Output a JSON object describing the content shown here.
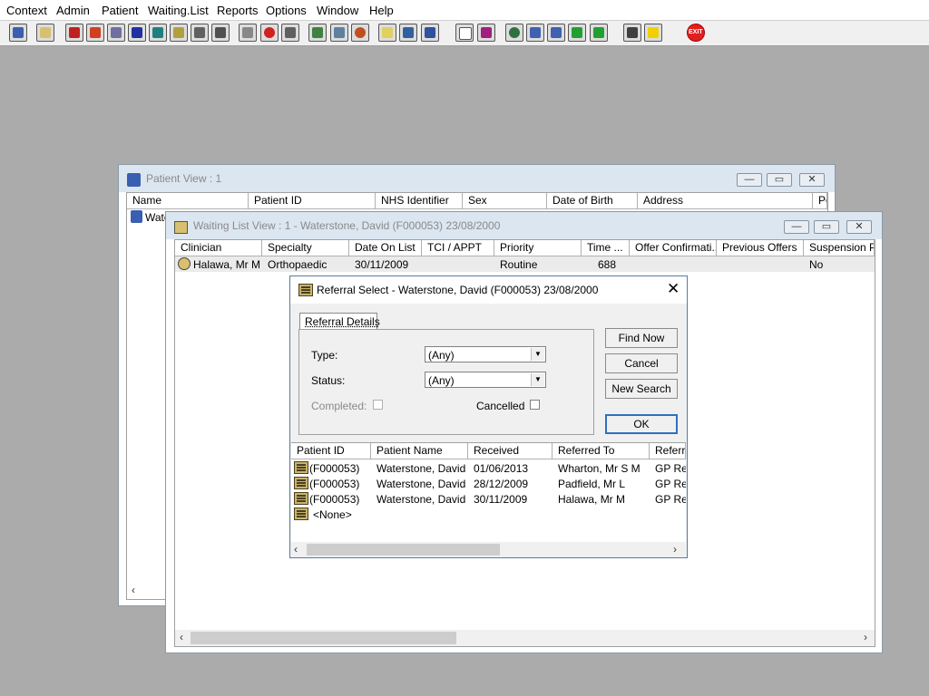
{
  "menu": [
    "Context",
    "Admin",
    "Patient",
    "Waiting.List",
    "Reports",
    "Options",
    "Window",
    "Help"
  ],
  "toolbar_icons": [
    "user-icon",
    "printer-icon",
    "book-icon",
    "edit-icon",
    "card-icon",
    "m-icon",
    "doctor-icon",
    "notepad-icon",
    "ambulance-icon",
    "vehicle-icon",
    "search-doc-icon",
    "clock-icon",
    "list-icon",
    "image-icon",
    "form-icon",
    "gauge-icon",
    "note-icon",
    "bed-icon",
    "person-chair-icon",
    "document-icon",
    "chart-icon",
    "globe-icon",
    "check-list-icon",
    "check-doc-icon",
    "arrow-down-icon",
    "arrow-up-icon",
    "transfer-icon",
    "warning-icon",
    "exit-icon"
  ],
  "exit_label": "EXIT",
  "patient_view": {
    "title": "Patient View : 1",
    "columns": [
      "Name",
      "Patient ID",
      "NHS Identifier",
      "Sex",
      "Date of Birth",
      "Address",
      "Po"
    ],
    "row_name": "Wate"
  },
  "waiting_list": {
    "title": "Waiting List View :  1 - Waterstone, David (F000053) 23/08/2000",
    "columns": [
      "Clinician",
      "Specialty",
      "Date On List",
      "TCI / APPT",
      "Priority",
      "Time ...",
      "Offer Confirmati...",
      "Previous Offers",
      "Suspension Pe"
    ],
    "row": {
      "clinician": "Halawa, Mr M",
      "specialty": "Orthopaedic",
      "date_on_list": "30/11/2009",
      "tci_appt": "",
      "priority": "Routine",
      "time": "688",
      "offer": "",
      "previous": "",
      "suspension": "No"
    }
  },
  "dialog": {
    "title": "Referral Select - Waterstone, David (F000053) 23/08/2000",
    "tab": "Referral Details",
    "type_label": "Type:",
    "type_value": "(Any)",
    "status_label": "Status:",
    "status_value": "(Any)",
    "completed_label": "Completed:",
    "cancelled_label": "Cancelled",
    "buttons": {
      "find": "Find Now",
      "cancel": "Cancel",
      "new_search": "New Search",
      "ok": "OK"
    },
    "columns": [
      "Patient ID",
      "Patient Name",
      "Received",
      "Referred To",
      "Referra"
    ],
    "rows": [
      {
        "id": "(F000053)",
        "name": "Waterstone, David",
        "received": "01/06/2013",
        "referred_to": "Wharton, Mr S M",
        "referral": "GP Re"
      },
      {
        "id": "(F000053)",
        "name": "Waterstone, David",
        "received": "28/12/2009",
        "referred_to": "Padfield, Mr L",
        "referral": "GP Re"
      },
      {
        "id": "(F000053)",
        "name": "Waterstone, David",
        "received": "30/11/2009",
        "referred_to": "Halawa, Mr M",
        "referral": "GP Re"
      }
    ],
    "none_row": "<None>"
  }
}
